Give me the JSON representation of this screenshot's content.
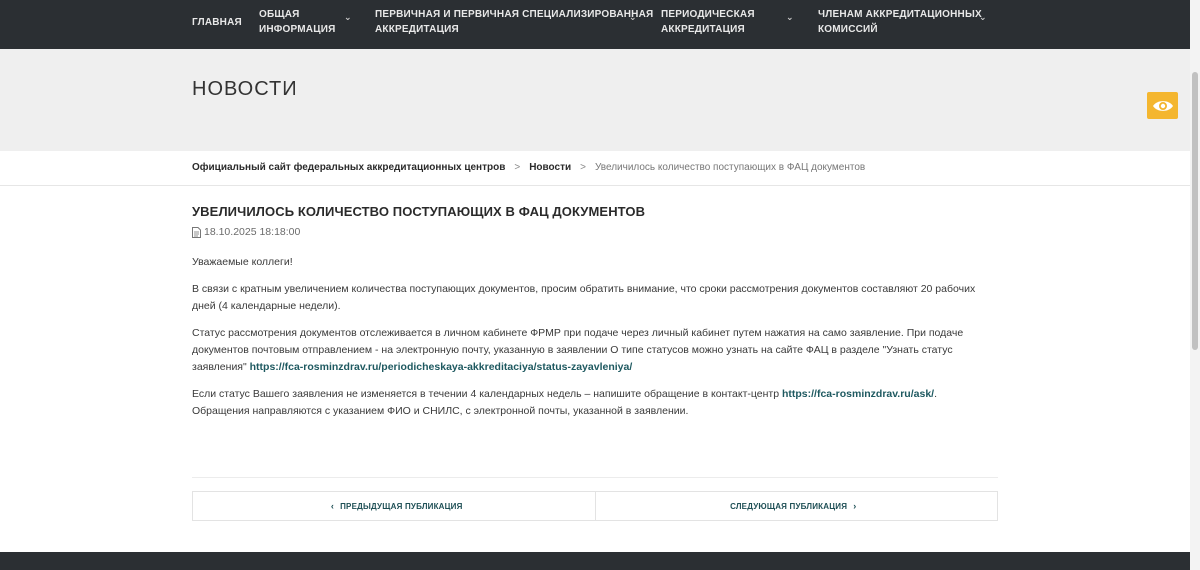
{
  "nav": {
    "items": [
      {
        "label": "Главная",
        "has_dropdown": false
      },
      {
        "label": "Общая\nинформация",
        "has_dropdown": true
      },
      {
        "label": "Первичная и первичная специализированная\nаккредитация",
        "has_dropdown": true
      },
      {
        "label": "Периодическая\nаккредитация",
        "has_dropdown": true
      },
      {
        "label": "Членам аккредитационных\nкомиссий",
        "has_dropdown": true
      }
    ],
    "chevron_icon": "chevron-down-icon",
    "background": "#2b2f33"
  },
  "hero": {
    "title": "НОВОСТИ",
    "accessibility_icon": "eye-icon",
    "accent": "#f4b62f"
  },
  "breadcrumb": {
    "items": [
      {
        "label": "Официальный сайт федеральных аккредитационных центров"
      },
      {
        "label": "Новости"
      }
    ],
    "current": "Увеличилось количество поступающих в ФАЦ документов",
    "separator": ">"
  },
  "article": {
    "title": "Увеличилось количество поступающих в ФАЦ документов",
    "date": "18.10.2025 18:18:00",
    "date_icon": "document-icon",
    "greeting": "Уважаемые коллеги!",
    "p1": "В связи с кратным увеличением количества поступающих документов, просим обратить внимание, что сроки рассмотрения документов составляют 20 рабочих дней (4 календарные недели).",
    "p2_text": "Статус рассмотрения документов отслеживается в личном кабинете ФРМР при подаче через личный кабинет путем нажатия на само заявление. При подаче документов почтовым отправлением - на электронную почту, указанную в заявлении О типе статусов можно узнать на сайте ФАЦ в разделе \"Узнать статус заявления\" ",
    "p2_link": "https://fca-rosminzdrav.ru/periodicheskaya-akkreditaciya/status-zayavleniya/",
    "p3_text": "Если статус Вашего заявления не изменяется в течении 4 календарных недель – напишите обращение в контакт-центр ",
    "p3_link": "https://fca-rosminzdrav.ru/ask/",
    "p3_after": ". Обращения направляются с указанием ФИО и СНИЛС, с электронной почты, указанной в заявлении.",
    "link_color": "#1e5960"
  },
  "pager": {
    "prev_label": "Предыдущая публикация",
    "next_label": "Следующая публикация",
    "prev_arrow": "‹",
    "next_arrow": "›"
  }
}
